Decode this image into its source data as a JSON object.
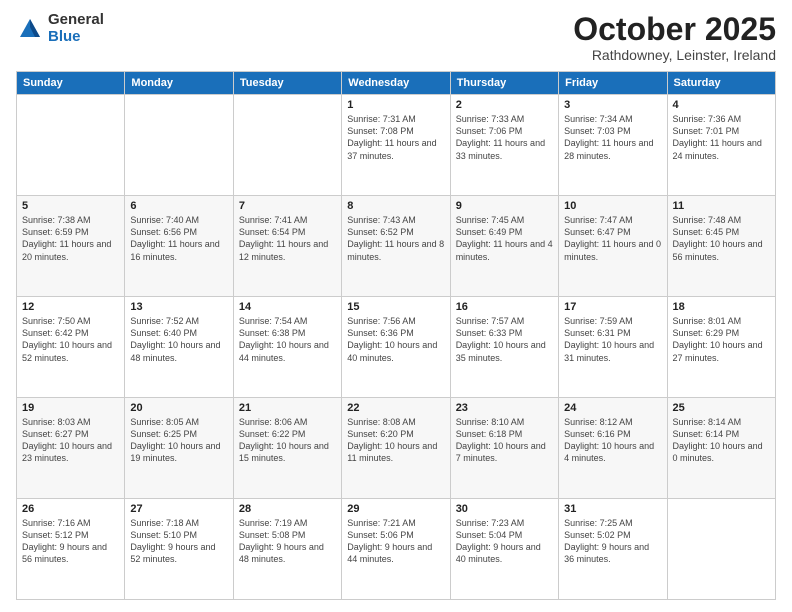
{
  "header": {
    "logo_general": "General",
    "logo_blue": "Blue",
    "month": "October 2025",
    "location": "Rathdowney, Leinster, Ireland"
  },
  "weekdays": [
    "Sunday",
    "Monday",
    "Tuesday",
    "Wednesday",
    "Thursday",
    "Friday",
    "Saturday"
  ],
  "weeks": [
    [
      {
        "day": "",
        "info": ""
      },
      {
        "day": "",
        "info": ""
      },
      {
        "day": "",
        "info": ""
      },
      {
        "day": "1",
        "info": "Sunrise: 7:31 AM\nSunset: 7:08 PM\nDaylight: 11 hours\nand 37 minutes."
      },
      {
        "day": "2",
        "info": "Sunrise: 7:33 AM\nSunset: 7:06 PM\nDaylight: 11 hours\nand 33 minutes."
      },
      {
        "day": "3",
        "info": "Sunrise: 7:34 AM\nSunset: 7:03 PM\nDaylight: 11 hours\nand 28 minutes."
      },
      {
        "day": "4",
        "info": "Sunrise: 7:36 AM\nSunset: 7:01 PM\nDaylight: 11 hours\nand 24 minutes."
      }
    ],
    [
      {
        "day": "5",
        "info": "Sunrise: 7:38 AM\nSunset: 6:59 PM\nDaylight: 11 hours\nand 20 minutes."
      },
      {
        "day": "6",
        "info": "Sunrise: 7:40 AM\nSunset: 6:56 PM\nDaylight: 11 hours\nand 16 minutes."
      },
      {
        "day": "7",
        "info": "Sunrise: 7:41 AM\nSunset: 6:54 PM\nDaylight: 11 hours\nand 12 minutes."
      },
      {
        "day": "8",
        "info": "Sunrise: 7:43 AM\nSunset: 6:52 PM\nDaylight: 11 hours\nand 8 minutes."
      },
      {
        "day": "9",
        "info": "Sunrise: 7:45 AM\nSunset: 6:49 PM\nDaylight: 11 hours\nand 4 minutes."
      },
      {
        "day": "10",
        "info": "Sunrise: 7:47 AM\nSunset: 6:47 PM\nDaylight: 11 hours\nand 0 minutes."
      },
      {
        "day": "11",
        "info": "Sunrise: 7:48 AM\nSunset: 6:45 PM\nDaylight: 10 hours\nand 56 minutes."
      }
    ],
    [
      {
        "day": "12",
        "info": "Sunrise: 7:50 AM\nSunset: 6:42 PM\nDaylight: 10 hours\nand 52 minutes."
      },
      {
        "day": "13",
        "info": "Sunrise: 7:52 AM\nSunset: 6:40 PM\nDaylight: 10 hours\nand 48 minutes."
      },
      {
        "day": "14",
        "info": "Sunrise: 7:54 AM\nSunset: 6:38 PM\nDaylight: 10 hours\nand 44 minutes."
      },
      {
        "day": "15",
        "info": "Sunrise: 7:56 AM\nSunset: 6:36 PM\nDaylight: 10 hours\nand 40 minutes."
      },
      {
        "day": "16",
        "info": "Sunrise: 7:57 AM\nSunset: 6:33 PM\nDaylight: 10 hours\nand 35 minutes."
      },
      {
        "day": "17",
        "info": "Sunrise: 7:59 AM\nSunset: 6:31 PM\nDaylight: 10 hours\nand 31 minutes."
      },
      {
        "day": "18",
        "info": "Sunrise: 8:01 AM\nSunset: 6:29 PM\nDaylight: 10 hours\nand 27 minutes."
      }
    ],
    [
      {
        "day": "19",
        "info": "Sunrise: 8:03 AM\nSunset: 6:27 PM\nDaylight: 10 hours\nand 23 minutes."
      },
      {
        "day": "20",
        "info": "Sunrise: 8:05 AM\nSunset: 6:25 PM\nDaylight: 10 hours\nand 19 minutes."
      },
      {
        "day": "21",
        "info": "Sunrise: 8:06 AM\nSunset: 6:22 PM\nDaylight: 10 hours\nand 15 minutes."
      },
      {
        "day": "22",
        "info": "Sunrise: 8:08 AM\nSunset: 6:20 PM\nDaylight: 10 hours\nand 11 minutes."
      },
      {
        "day": "23",
        "info": "Sunrise: 8:10 AM\nSunset: 6:18 PM\nDaylight: 10 hours\nand 7 minutes."
      },
      {
        "day": "24",
        "info": "Sunrise: 8:12 AM\nSunset: 6:16 PM\nDaylight: 10 hours\nand 4 minutes."
      },
      {
        "day": "25",
        "info": "Sunrise: 8:14 AM\nSunset: 6:14 PM\nDaylight: 10 hours\nand 0 minutes."
      }
    ],
    [
      {
        "day": "26",
        "info": "Sunrise: 7:16 AM\nSunset: 5:12 PM\nDaylight: 9 hours\nand 56 minutes."
      },
      {
        "day": "27",
        "info": "Sunrise: 7:18 AM\nSunset: 5:10 PM\nDaylight: 9 hours\nand 52 minutes."
      },
      {
        "day": "28",
        "info": "Sunrise: 7:19 AM\nSunset: 5:08 PM\nDaylight: 9 hours\nand 48 minutes."
      },
      {
        "day": "29",
        "info": "Sunrise: 7:21 AM\nSunset: 5:06 PM\nDaylight: 9 hours\nand 44 minutes."
      },
      {
        "day": "30",
        "info": "Sunrise: 7:23 AM\nSunset: 5:04 PM\nDaylight: 9 hours\nand 40 minutes."
      },
      {
        "day": "31",
        "info": "Sunrise: 7:25 AM\nSunset: 5:02 PM\nDaylight: 9 hours\nand 36 minutes."
      },
      {
        "day": "",
        "info": ""
      }
    ]
  ]
}
